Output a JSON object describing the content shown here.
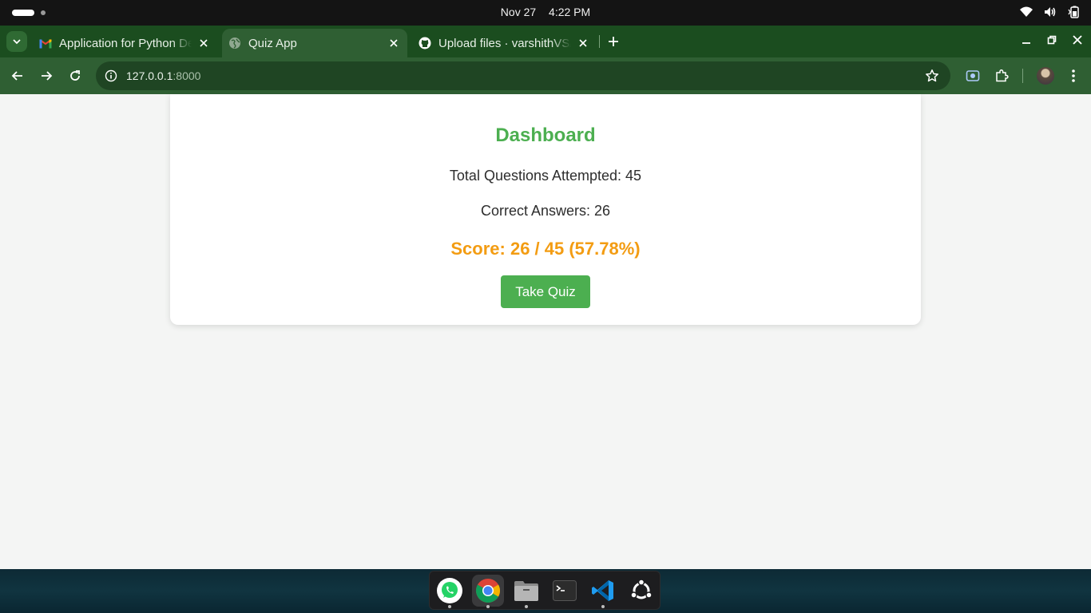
{
  "system": {
    "date": "Nov 27",
    "time": "4:22 PM",
    "icons": [
      "wifi-icon",
      "volume-icon",
      "battery-icon"
    ]
  },
  "browser": {
    "tabs": [
      {
        "title": "Application for Python Developer",
        "favicon": "gmail-icon",
        "active": false
      },
      {
        "title": "Quiz App",
        "favicon": "globe-icon",
        "active": true
      },
      {
        "title": "Upload files · varshithVS/",
        "favicon": "github-icon",
        "active": false
      }
    ],
    "url_host": "127.0.0.1",
    "url_port": ":8000",
    "colors": {
      "frame": "#1b4d1f",
      "toolbar": "#2f5f33"
    }
  },
  "dashboard": {
    "title": "Dashboard",
    "total_label": "Total Questions Attempted: 45",
    "correct_label": "Correct Answers: 26",
    "score_label": "Score: 26 / 45 (57.78%)",
    "take_quiz_label": "Take Quiz",
    "colors": {
      "title": "#4caf50",
      "score": "#f39c12",
      "button": "#4caf50"
    }
  },
  "dock": {
    "apps": [
      "whatsapp-icon",
      "chrome-icon",
      "files-icon",
      "terminal-icon",
      "vscode-icon",
      "ubuntu-apps-icon"
    ]
  }
}
